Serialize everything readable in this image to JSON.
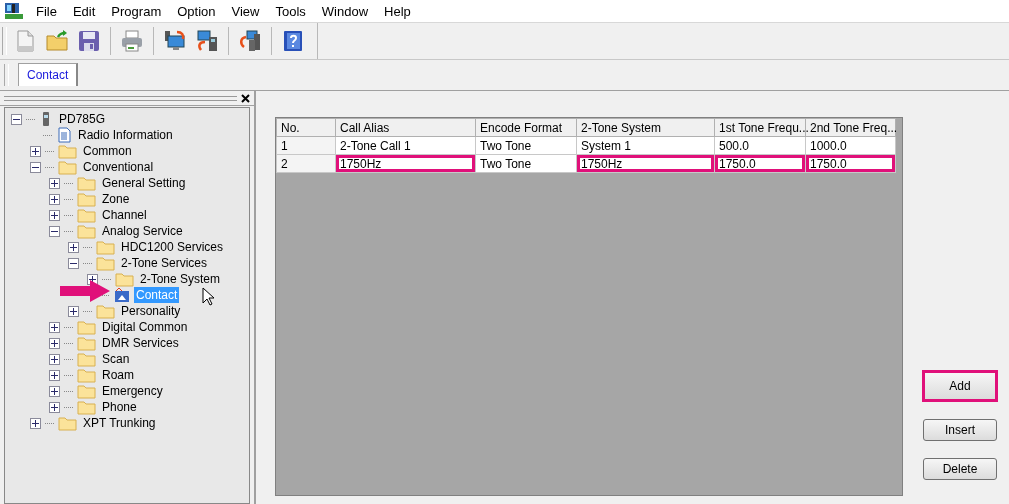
{
  "menu": [
    "File",
    "Edit",
    "Program",
    "Option",
    "View",
    "Tools",
    "Window",
    "Help"
  ],
  "tabs": [
    {
      "label": "Contact",
      "selected": true
    }
  ],
  "tree": [
    {
      "label": "PD785G",
      "kind": "device",
      "expanded": true,
      "selected": false,
      "children": [
        {
          "label": "Radio Information",
          "kind": "document",
          "selected": false
        },
        {
          "label": "Common",
          "kind": "folder",
          "expanded": false,
          "selected": false
        },
        {
          "label": "Conventional",
          "kind": "folder",
          "expanded": true,
          "selected": false,
          "children": [
            {
              "label": "General Setting",
              "kind": "folder",
              "expanded": false,
              "selected": false
            },
            {
              "label": "Zone",
              "kind": "folder",
              "expanded": false,
              "selected": false
            },
            {
              "label": "Channel",
              "kind": "folder",
              "expanded": false,
              "selected": false
            },
            {
              "label": "Analog Service",
              "kind": "folder",
              "expanded": true,
              "selected": false,
              "children": [
                {
                  "label": "HDC1200 Services",
                  "kind": "folder",
                  "expanded": false,
                  "selected": false
                },
                {
                  "label": "2-Tone Services",
                  "kind": "folder",
                  "expanded": true,
                  "selected": false,
                  "children": [
                    {
                      "label": "2-Tone System",
                      "kind": "folder",
                      "expanded": false,
                      "selected": false
                    },
                    {
                      "label": "Contact",
                      "kind": "contact",
                      "selected": true
                    }
                  ]
                },
                {
                  "label": "Personality",
                  "kind": "folder",
                  "expanded": false,
                  "selected": false
                }
              ]
            },
            {
              "label": "Digital Common",
              "kind": "folder",
              "expanded": false,
              "selected": false
            },
            {
              "label": "DMR Services",
              "kind": "folder",
              "expanded": false,
              "selected": false
            },
            {
              "label": "Scan",
              "kind": "folder",
              "expanded": false,
              "selected": false
            },
            {
              "label": "Roam",
              "kind": "folder",
              "expanded": false,
              "selected": false
            },
            {
              "label": "Emergency",
              "kind": "folder",
              "expanded": false,
              "selected": false
            },
            {
              "label": "Phone",
              "kind": "folder",
              "expanded": false,
              "selected": false
            }
          ]
        },
        {
          "label": "XPT Trunking",
          "kind": "folder",
          "expanded": false,
          "selected": false
        }
      ]
    }
  ],
  "table": {
    "columns": [
      "No.",
      "Call Alias",
      "Encode Format",
      "2-Tone System",
      "1st Tone Frequ...",
      "2nd Tone Freq..."
    ],
    "rows": [
      [
        {
          "text": "1",
          "highlighted": false
        },
        {
          "text": "2-Tone Call 1",
          "highlighted": false
        },
        {
          "text": "Two Tone",
          "highlighted": false
        },
        {
          "text": "System 1",
          "highlighted": false
        },
        {
          "text": "500.0",
          "highlighted": false
        },
        {
          "text": "1000.0",
          "highlighted": false
        }
      ],
      [
        {
          "text": "2",
          "highlighted": false
        },
        {
          "text": "1750Hz",
          "highlighted": true
        },
        {
          "text": "Two Tone",
          "highlighted": false
        },
        {
          "text": "1750Hz",
          "highlighted": true
        },
        {
          "text": "1750.0",
          "highlighted": true
        },
        {
          "text": "1750.0",
          "highlighted": true
        }
      ]
    ]
  },
  "buttons": [
    {
      "label": "Add",
      "highlighted": true
    },
    {
      "label": "Insert",
      "highlighted": false
    },
    {
      "label": "Delete",
      "highlighted": false
    }
  ]
}
